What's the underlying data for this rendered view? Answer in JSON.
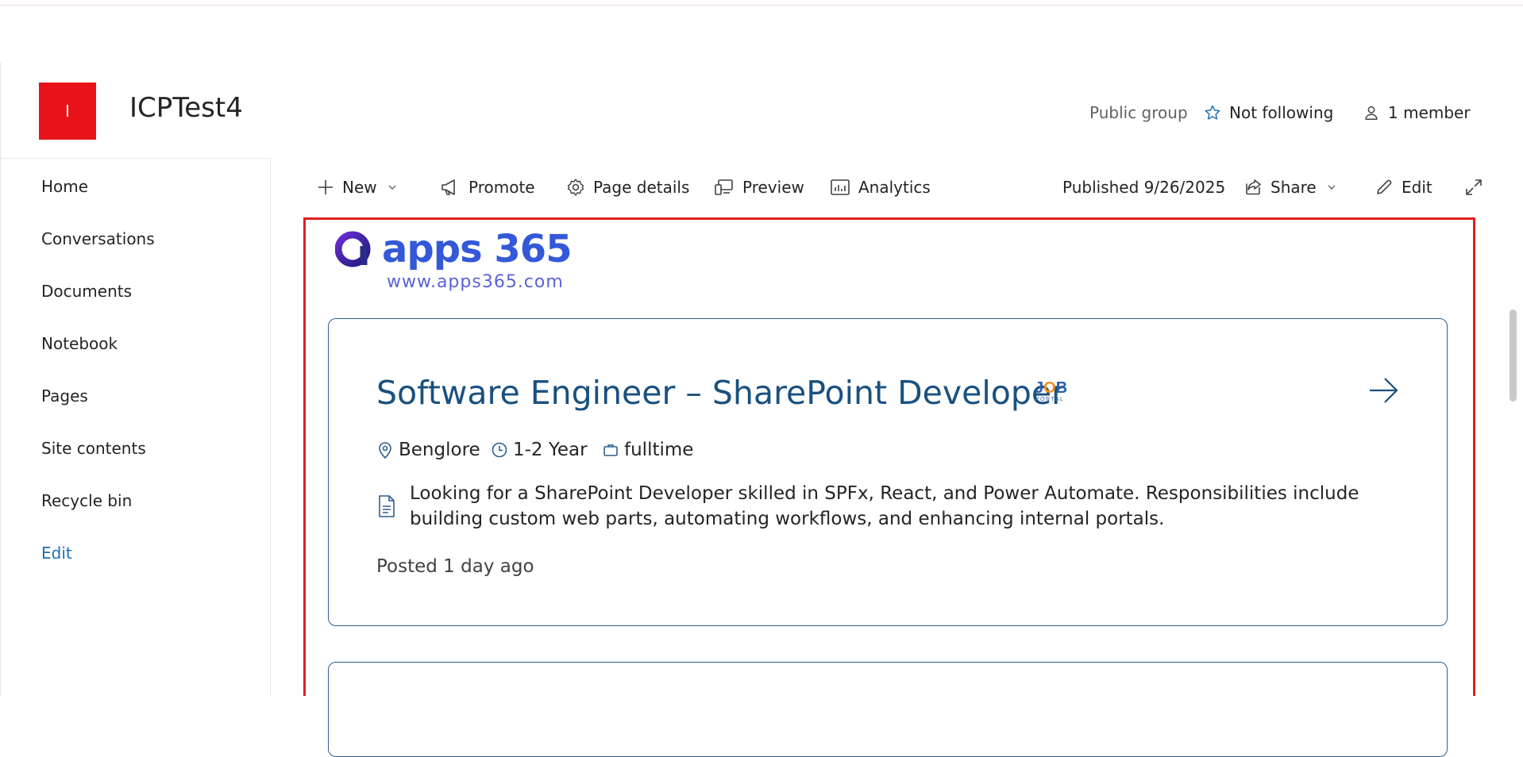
{
  "site": {
    "logo_letter": "I",
    "title": "ICPTest4",
    "visibility": "Public group",
    "follow_label": "Not following",
    "members_label": "1 member"
  },
  "nav": {
    "items": [
      "Home",
      "Conversations",
      "Documents",
      "Notebook",
      "Pages",
      "Site contents",
      "Recycle bin"
    ],
    "edit_label": "Edit"
  },
  "commandbar": {
    "new_label": "New",
    "promote_label": "Promote",
    "page_details_label": "Page details",
    "preview_label": "Preview",
    "analytics_label": "Analytics",
    "published_label": "Published 9/26/2025",
    "share_label": "Share",
    "edit_label": "Edit"
  },
  "brand": {
    "name": "apps 365",
    "url": "www.apps365.com"
  },
  "job": {
    "title": "Software Engineer – SharePoint Developer",
    "badge_text": "JOB",
    "badge_sub": "PORTAL",
    "location": "Benglore",
    "experience": "1-2 Year",
    "type": "fulltime",
    "description": "Looking for a SharePoint Developer skilled in SPFx, React, and Power Automate. Responsibilities include building custom web parts, automating workflows, and enhancing internal portals.",
    "posted": "Posted 1 day ago"
  },
  "colors": {
    "site_logo_bg": "#e8131a",
    "accent_blue": "#19507f",
    "highlight_border": "#e02020",
    "brand_blue": "#3358d8"
  }
}
